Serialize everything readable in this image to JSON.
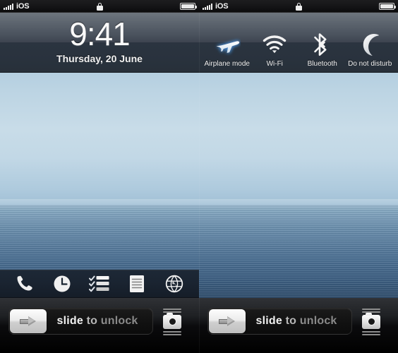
{
  "status_bar": {
    "carrier": "iOS",
    "signal_bars": 5,
    "lock_icon": "lock-icon",
    "battery_icon": "battery-icon",
    "battery_level_full": true
  },
  "lock_screen": {
    "time": "9:41",
    "date": "Thursday, 20 June"
  },
  "control_toggles": [
    {
      "id": "airplane-mode",
      "label": "Airplane mode",
      "icon": "airplane-icon",
      "active": true,
      "glow_color": "#4a90d9"
    },
    {
      "id": "wifi",
      "label": "Wi-Fi",
      "icon": "wifi-icon",
      "active": false,
      "glow_color": ""
    },
    {
      "id": "bluetooth",
      "label": "Bluetooth",
      "icon": "bluetooth-icon",
      "active": false,
      "glow_color": ""
    },
    {
      "id": "do-not-disturb",
      "label": "Do not disturb",
      "icon": "moon-icon",
      "active": false,
      "glow_color": ""
    }
  ],
  "dock": [
    {
      "id": "phone",
      "icon": "phone-icon"
    },
    {
      "id": "clock",
      "icon": "clock-icon"
    },
    {
      "id": "reminders",
      "icon": "checklist-icon"
    },
    {
      "id": "notes",
      "icon": "notes-icon"
    },
    {
      "id": "safari",
      "icon": "globe-icon"
    }
  ],
  "unlock": {
    "slider_arrow_icon": "arrow-right-icon",
    "text_word_1": "slide",
    "text_word_2": "to",
    "text_word_3": "unlock",
    "camera_icon": "camera-icon",
    "camera_grip_icon": "grip-lines-icon"
  },
  "colors": {
    "status_bar_bg": "#111113",
    "header_top": "#6d757e",
    "header_bottom": "#273039",
    "dock_bg": "#1a2431",
    "sky": "#c8dce8",
    "water": "#2b4863",
    "accent_blue": "#4a90d9"
  }
}
